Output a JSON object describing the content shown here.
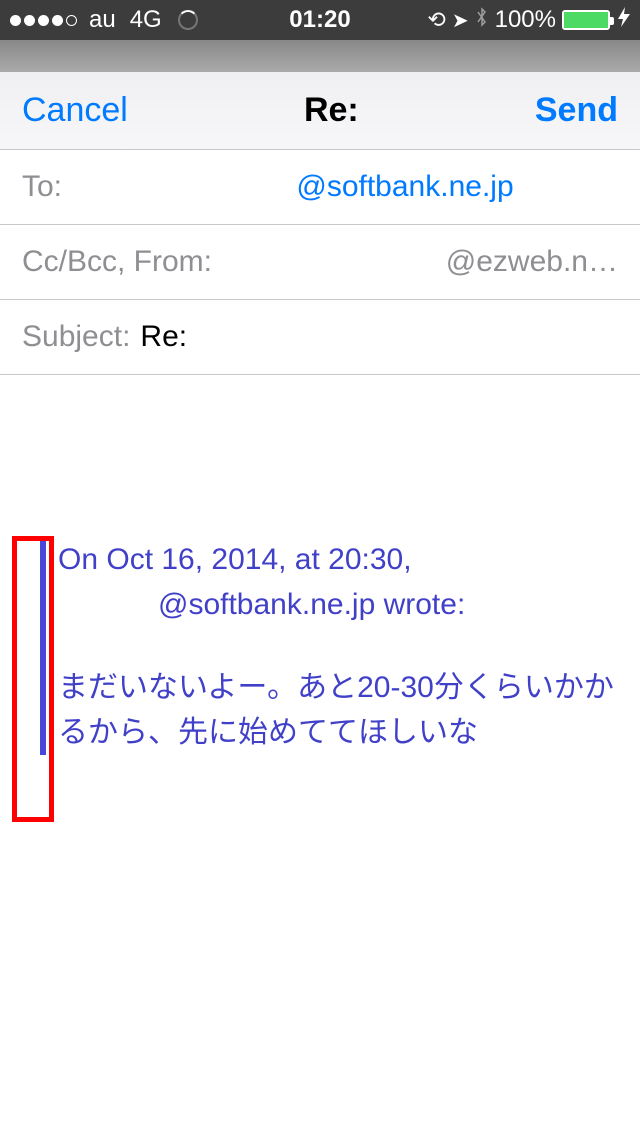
{
  "status": {
    "carrier": "au",
    "network": "4G",
    "time": "01:20",
    "battery_pct": "100%"
  },
  "nav": {
    "cancel": "Cancel",
    "title": "Re:",
    "send": "Send"
  },
  "fields": {
    "to_label": "To:",
    "to_value": "@softbank.ne.jp",
    "ccbcc_label": "Cc/Bcc, From:",
    "from_value": "@ezweb.n…",
    "subject_label": "Subject:",
    "subject_value": "Re:"
  },
  "quote": {
    "line1": "On Oct 16, 2014, at 20:30,",
    "line2": "@softbank.ne.jp wrote:",
    "body": "まだいないよー。あと20-30分くらいかかるから、先に始めててほしいな"
  }
}
